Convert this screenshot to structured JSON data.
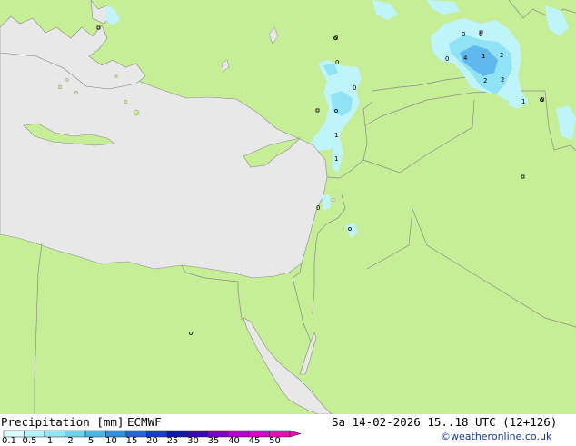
{
  "footer": {
    "title": "Precipitation [mm]",
    "model": "ECMWF",
    "datetime": "Sa 14-02-2026 15..18 UTC (12+126)",
    "credit": "©weatheronline.co.uk"
  },
  "legend": {
    "labels": [
      "0.1",
      "0.5",
      "1",
      "2",
      "5",
      "10",
      "15",
      "20",
      "25",
      "30",
      "35",
      "40",
      "45",
      "50"
    ],
    "colors": [
      "#d9fbff",
      "#b3f3fb",
      "#8fe6f6",
      "#6ad3f0",
      "#48b6ea",
      "#2f8fe0",
      "#2366d4",
      "#1940c2",
      "#0d1aa8",
      "#3a0ab0",
      "#7a06c4",
      "#b004cc",
      "#d808c8",
      "#f00ab4"
    ]
  },
  "map_values": [
    "0",
    "0",
    "0",
    "0",
    "4",
    "1",
    "2",
    "2",
    "2",
    "1",
    "0",
    "0",
    "0",
    "1",
    "1",
    "0"
  ],
  "colors": {
    "land": "#c6ee96",
    "sea": "#e8e8e8",
    "border": "#8a8a8a",
    "precip_light": "#c0f4fb",
    "precip_mid": "#8fe3f5",
    "precip_heavy": "#5fb8ee"
  }
}
